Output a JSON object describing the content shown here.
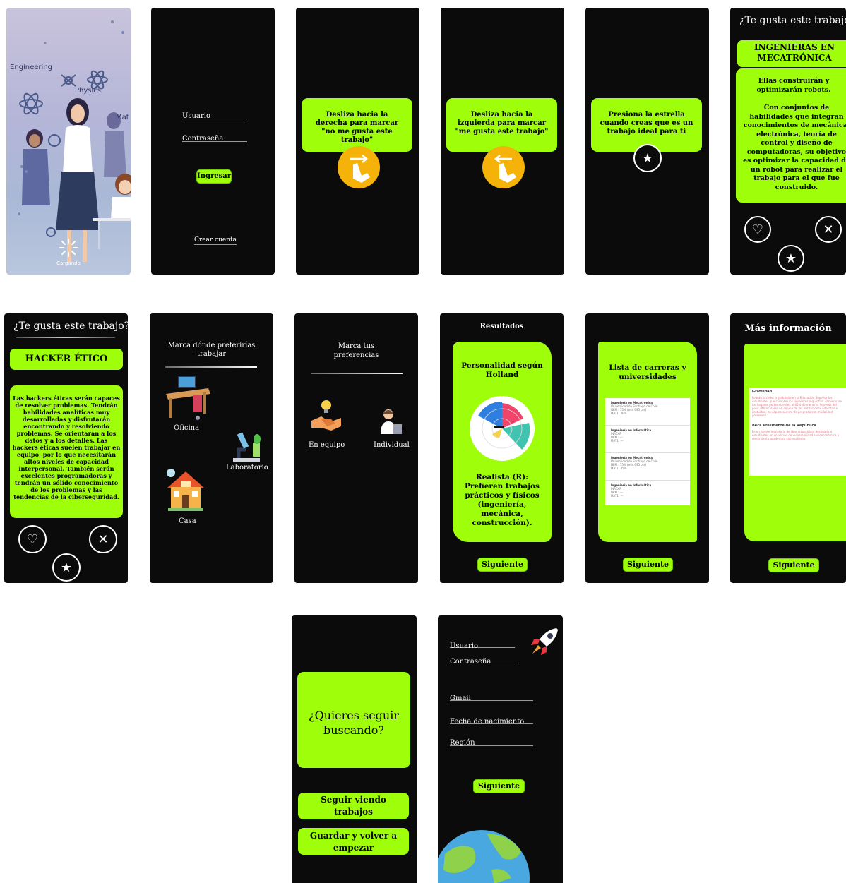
{
  "splash": {
    "physics": "Physics",
    "engineering": "Engineering",
    "math": "Mat",
    "loading": "Cargando"
  },
  "login": {
    "user": "Usuario",
    "password": "Contraseña",
    "submit": "Ingresar",
    "create": "Crear cuenta"
  },
  "tut_right": {
    "text": "Desliza hacia la derecha para marcar \"no me gusta este trabajo\""
  },
  "tut_left": {
    "text": "Desliza hacia la izquierda para marcar \"me gusta este trabajo\""
  },
  "tut_star": {
    "text": "Presiona la estrella cuando creas que es un trabajo ideal para ti"
  },
  "mecatronica": {
    "question": "¿Te gusta este trabajo?",
    "title": "INGENIERAS EN MECATRÓNICA",
    "desc1": "Ellas construirán y optimizarán robots.",
    "desc2": "Con conjuntos de habilidades que integran conocimientos de mecánica, electrónica, teoría de control y diseño de computadoras, su objetivo es optimizar la capacidad de un robot para realizar el trabajo para el que fue construido."
  },
  "hacker": {
    "question": "¿Te gusta este trabajo?",
    "title": "HACKER ÉTICO",
    "desc": "Las hackers éticas serán capaces de resolver problemas. Tendrán habilidades analíticas muy desarrolladas y disfrutarán encontrando y resolviendo problemas. Se orientarán a los datos y a los detalles. Las hackers éticas suelen trabajar en equipo, por lo que necesitarán altos niveles de capacidad interpersonal. También serán excelentes programadoras y tendrán un sólido conocimiento de los problemas y las tendencias de la ciberseguridad."
  },
  "workplace": {
    "title": "Marca dónde preferirías trabajar",
    "office": "Oficina",
    "lab": "Laboratorio",
    "home": "Casa"
  },
  "prefs": {
    "title": "Marca tus preferencias",
    "team": "En equipo",
    "individual": "Individual"
  },
  "results": {
    "title": "Resultados",
    "heading": "Personalidad según Holland",
    "body": "Realista (R): Prefieren trabajos prácticos y físicos (ingeniería, mecánica, construcción).",
    "next": "Siguiente",
    "chart_colors": [
      "#2f7fe0",
      "#f0446b",
      "#40c4b0",
      "#f6d24a"
    ]
  },
  "careers": {
    "title": "Lista de carreras y universidades",
    "items": [
      {
        "name": "Ingeniería en Mecatrónica",
        "uni": "Universidad de Santiago de Chile",
        "nem": "NEM : 15% (min 695 pts)",
        "mat": "MAT1: 30%"
      },
      {
        "name": "Ingeniería en Informática",
        "uni": "INACAP",
        "nem": "NEM : ---",
        "mat": "MAT1: ---"
      },
      {
        "name": "Ingeniería en Mecatrónica",
        "uni": "Universidad de Santiago de Chile",
        "nem": "NEM : 15% (min 695 pts)",
        "mat": "MAT1: 35%"
      },
      {
        "name": "Ingeniería en Informática",
        "uni": "INACAP",
        "nem": "NEM : ---",
        "mat": "MAT1: ---"
      }
    ],
    "next": "Siguiente"
  },
  "moreinfo": {
    "title": "Más información",
    "h1": "Gratuidad",
    "p1": "Podrán acceder a gratuidad en la Educación Superior los estudiantes que cumplan los siguientes requisitos: -Provenir de los hogares pertenecientes al 60% de menores ingresos del país. -Matricularse en alguna de las instituciones adscritas a gratuidad, en alguna carrera de pregrado con modalidad presencial.",
    "h2": "Beca Presidente de la República",
    "p2": "Es un aporte monetario de libre disposición, destinado a estudiantes en condición de vulnerabilidad socioeconómica y rendimiento académico sobresaliente.",
    "next": "Siguiente"
  },
  "continue": {
    "question": "¿Quieres seguir buscando?",
    "keep": "Seguir viendo trabajos",
    "save": "Guardar y volver a empezar"
  },
  "register": {
    "user": "Usuario",
    "password": "Contraseña",
    "gmail": "Gmail",
    "birth": "Fecha de nacimiento",
    "region": "Región",
    "next": "Siguiente"
  }
}
